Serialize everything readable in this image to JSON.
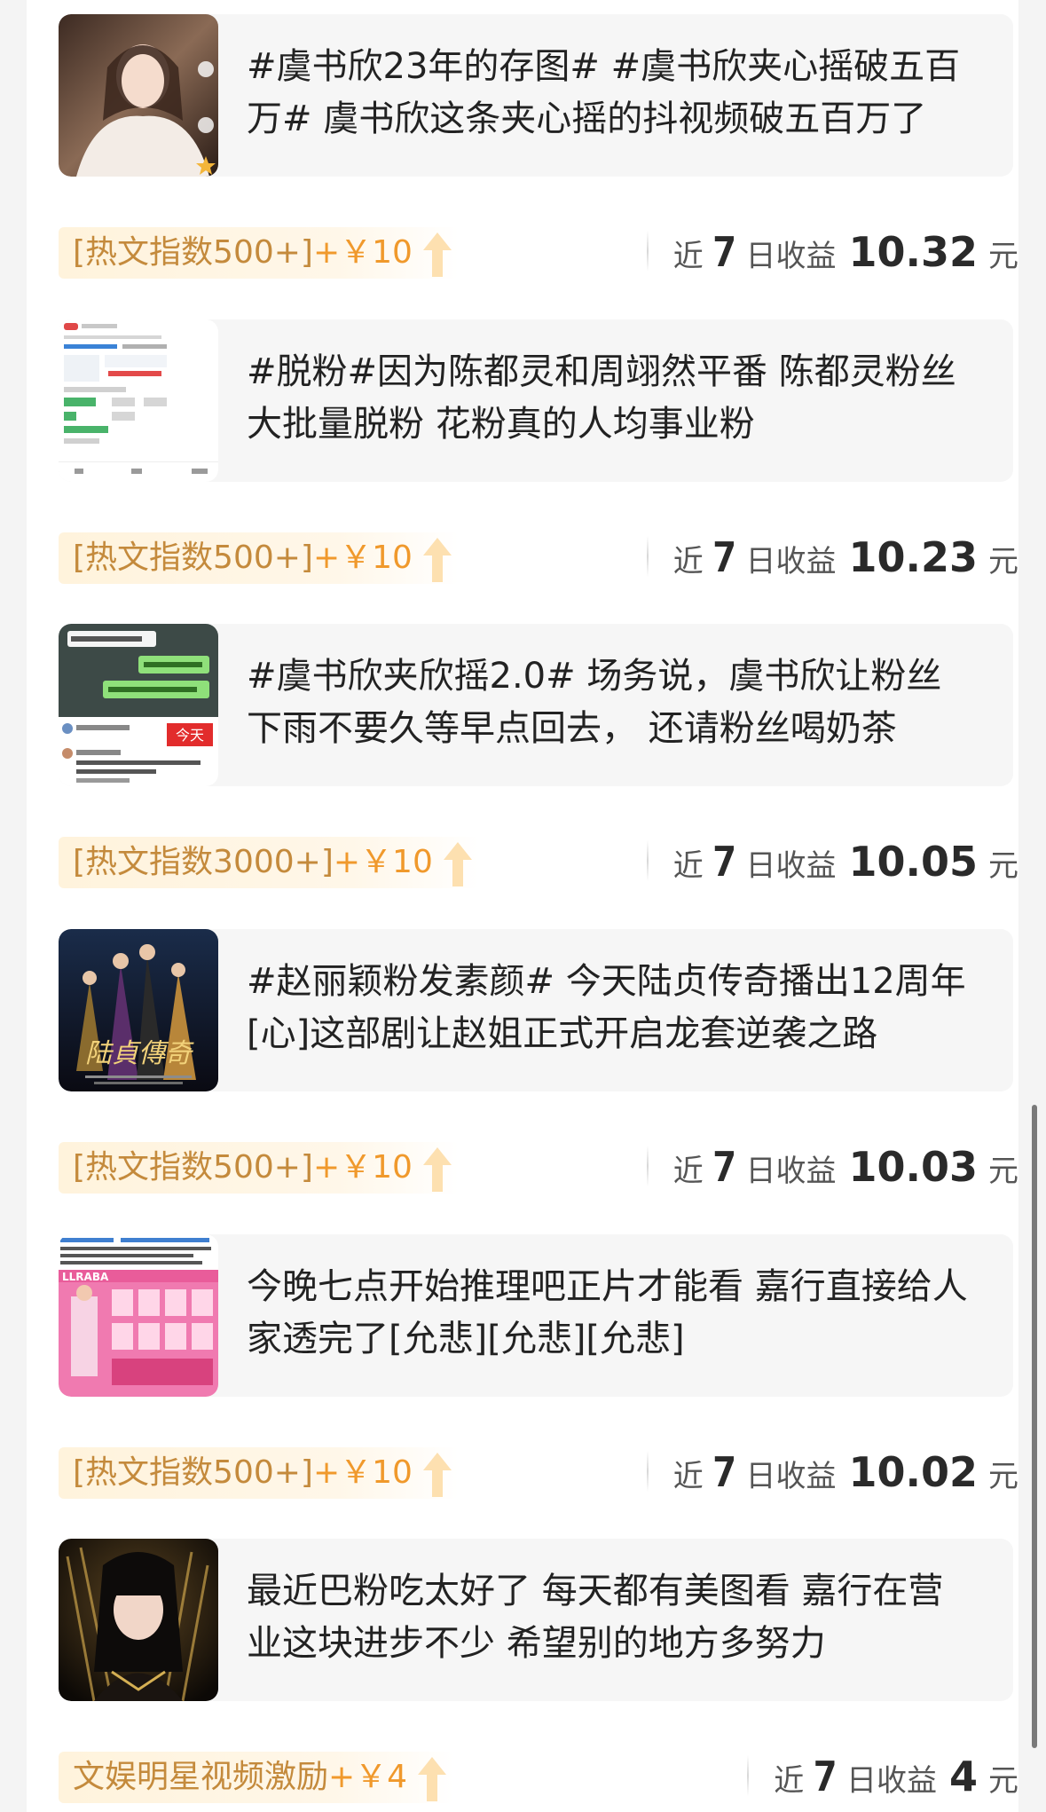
{
  "items": [
    {
      "title": "#虞书欣23年的存图# #虞书欣夹心摇破五百万# 虞书欣这条夹心摇的抖视频破五百万了",
      "tag_label": "[热文指数500+]",
      "tag_bonus": "+￥10",
      "earn_prefix": "近",
      "earn_days": "7",
      "earn_middle": "日收益",
      "earn_amount": "10.32",
      "earn_unit": "元",
      "thumb_icon": "portrait-photo"
    },
    {
      "title": "#脱粉#因为陈都灵和周翊然平番 陈都灵粉丝大批量脱粉 花粉真的人均事业粉",
      "tag_label": "[热文指数500+]",
      "tag_bonus": "+￥10",
      "earn_prefix": "近",
      "earn_days": "7",
      "earn_middle": "日收益",
      "earn_amount": "10.23",
      "earn_unit": "元",
      "thumb_icon": "chat-screenshot"
    },
    {
      "title": "#虞书欣夹欣摇2.0# 场务说，虞书欣让粉丝下雨不要久等早点回去， 还请粉丝喝奶茶",
      "tag_label": "[热文指数3000+]",
      "tag_bonus": "+￥10",
      "earn_prefix": "近",
      "earn_days": "7",
      "earn_middle": "日收益",
      "earn_amount": "10.05",
      "earn_unit": "元",
      "thumb_icon": "message-screenshot"
    },
    {
      "title": "#赵丽颖粉发素颜# 今天陆贞传奇播出12周年[心]这部剧让赵姐正式开启龙套逆袭之路",
      "tag_label": "[热文指数500+]",
      "tag_bonus": "+￥10",
      "earn_prefix": "近",
      "earn_days": "7",
      "earn_middle": "日收益",
      "earn_amount": "10.03",
      "earn_unit": "元",
      "thumb_icon": "drama-poster"
    },
    {
      "title": "今晚七点开始推理吧正片才能看 嘉行直接给人家透完了[允悲][允悲][允悲]",
      "tag_label": "[热文指数500+]",
      "tag_bonus": "+￥10",
      "earn_prefix": "近",
      "earn_days": "7",
      "earn_middle": "日收益",
      "earn_amount": "10.02",
      "earn_unit": "元",
      "thumb_icon": "pink-poster"
    },
    {
      "title": "最近巴粉吃太好了 每天都有美图看 嘉行在营业这块进步不少 希望别的地方多努力",
      "tag_label": "文娱明星视频激励",
      "tag_bonus": "+￥4",
      "earn_prefix": "近",
      "earn_days": "7",
      "earn_middle": "日收益",
      "earn_amount": "4",
      "earn_unit": "元",
      "thumb_icon": "portrait-dark"
    }
  ]
}
